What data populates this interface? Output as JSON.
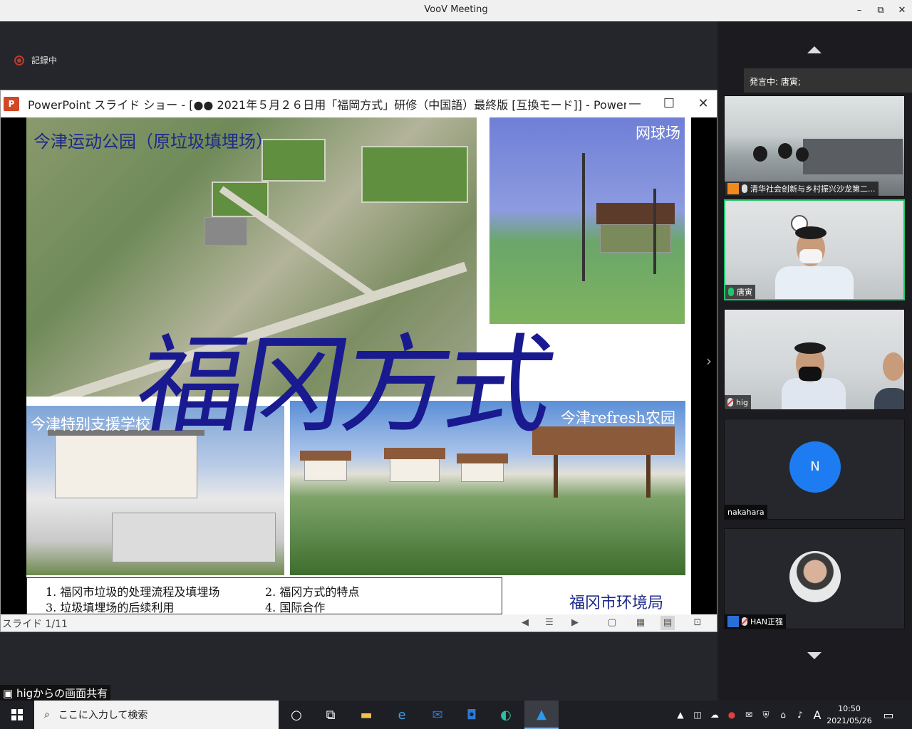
{
  "app": {
    "title": "VooV Meeting",
    "window_controls": [
      "–",
      "⧉",
      "✕"
    ]
  },
  "recording": {
    "label": "記録中",
    "color": "#c0392b"
  },
  "powerpoint": {
    "title": "PowerPoint スライド ショー - [●● 2021年５月２６日用「福岡方式」研修（中国語）最終版 [互換モード]] - Power...",
    "controls": [
      "—",
      "☐",
      "✕"
    ],
    "slide": {
      "heading": "今津运动公园（原垃圾填埋场）",
      "tennis_caption": "网球场",
      "school_caption": "今津特别支援学校",
      "farm_caption": "今津refresh农园",
      "big_title": "福冈方式",
      "agenda": [
        "1. 福冈市垃圾的处理流程及填埋场",
        "2. 福冈方式的特点",
        "3. 垃圾填埋场的后续利用",
        "4. 国际合作"
      ],
      "bureau": "福冈市环境局"
    },
    "status": {
      "slide_number": "スライド 1/11"
    }
  },
  "share_label": "higからの画面共有",
  "sidebar": {
    "speaking": "発言中: 唐寅;",
    "participants": [
      {
        "name": "清华社会创新与乡村振兴沙龙第二...",
        "mic": "on",
        "kind": "video"
      },
      {
        "name": "唐寅",
        "mic": "active",
        "kind": "video"
      },
      {
        "name": "hig",
        "mic": "muted",
        "kind": "video"
      },
      {
        "name": "nakahara",
        "initial": "N",
        "kind": "avatar",
        "color": "#1e7cf2"
      },
      {
        "name": "HAN正强",
        "mic": "muted",
        "kind": "photo"
      }
    ]
  },
  "taskbar": {
    "search_placeholder": "ここに入力して検索",
    "time": "10:50",
    "date": "2021/05/26",
    "ime": "A"
  }
}
